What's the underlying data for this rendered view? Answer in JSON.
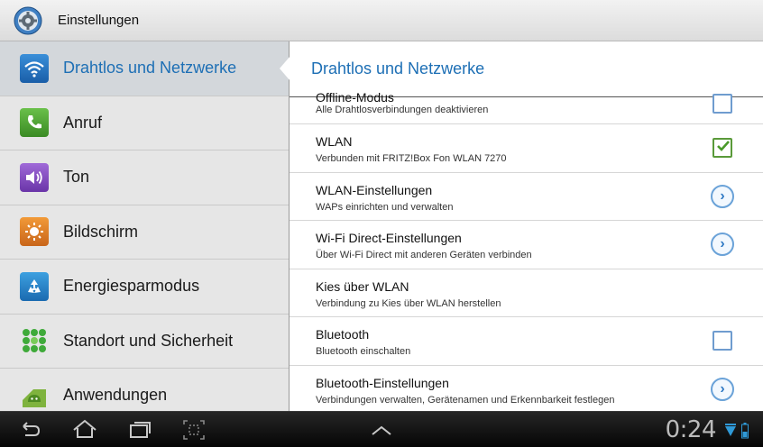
{
  "app": {
    "title": "Einstellungen",
    "icon": "gear-icon"
  },
  "sidebar": {
    "items": [
      {
        "label": "Drahtlos und Netzwerke",
        "icon": "wifi-icon",
        "active": true
      },
      {
        "label": "Anruf",
        "icon": "phone-icon",
        "active": false
      },
      {
        "label": "Ton",
        "icon": "speaker-icon",
        "active": false
      },
      {
        "label": "Bildschirm",
        "icon": "brightness-icon",
        "active": false
      },
      {
        "label": "Energiesparmodus",
        "icon": "recycle-icon",
        "active": false
      },
      {
        "label": "Standort und Sicherheit",
        "icon": "location-grid-icon",
        "active": false
      },
      {
        "label": "Anwendungen",
        "icon": "android-icon",
        "active": false
      }
    ]
  },
  "panel": {
    "header": "Drahtlos und Netzwerke",
    "rows": [
      {
        "title": "Offline-Modus",
        "subtitle": "Alle Drahtlosverbindungen deaktivieren",
        "control": "checkbox",
        "checked": false
      },
      {
        "title": "WLAN",
        "subtitle": "Verbunden mit FRITZ!Box Fon WLAN 7270",
        "control": "checkbox",
        "checked": true
      },
      {
        "title": "WLAN-Einstellungen",
        "subtitle": "WAPs einrichten und verwalten",
        "control": "chevron"
      },
      {
        "title": "Wi-Fi Direct-Einstellungen",
        "subtitle": "Über Wi-Fi Direct mit anderen Geräten verbinden",
        "control": "chevron"
      },
      {
        "title": "Kies über WLAN",
        "subtitle": "Verbindung zu Kies über WLAN herstellen",
        "control": "none"
      },
      {
        "title": "Bluetooth",
        "subtitle": "Bluetooth einschalten",
        "control": "checkbox",
        "checked": false
      },
      {
        "title": "Bluetooth-Einstellungen",
        "subtitle": "Verbindungen verwalten, Gerätenamen und Erkennbarkeit festlegen",
        "control": "chevron"
      }
    ]
  },
  "navbar": {
    "clock": "0:24",
    "buttons": [
      "back-icon",
      "home-icon",
      "recent-apps-icon",
      "screenshot-icon",
      "up-arrow-icon"
    ],
    "status_icons": [
      "wifi-signal-icon",
      "battery-icon"
    ]
  },
  "colors": {
    "accent": "#1d6fb5",
    "check": "#5a9a3a",
    "chevron": "#2f79c4"
  }
}
